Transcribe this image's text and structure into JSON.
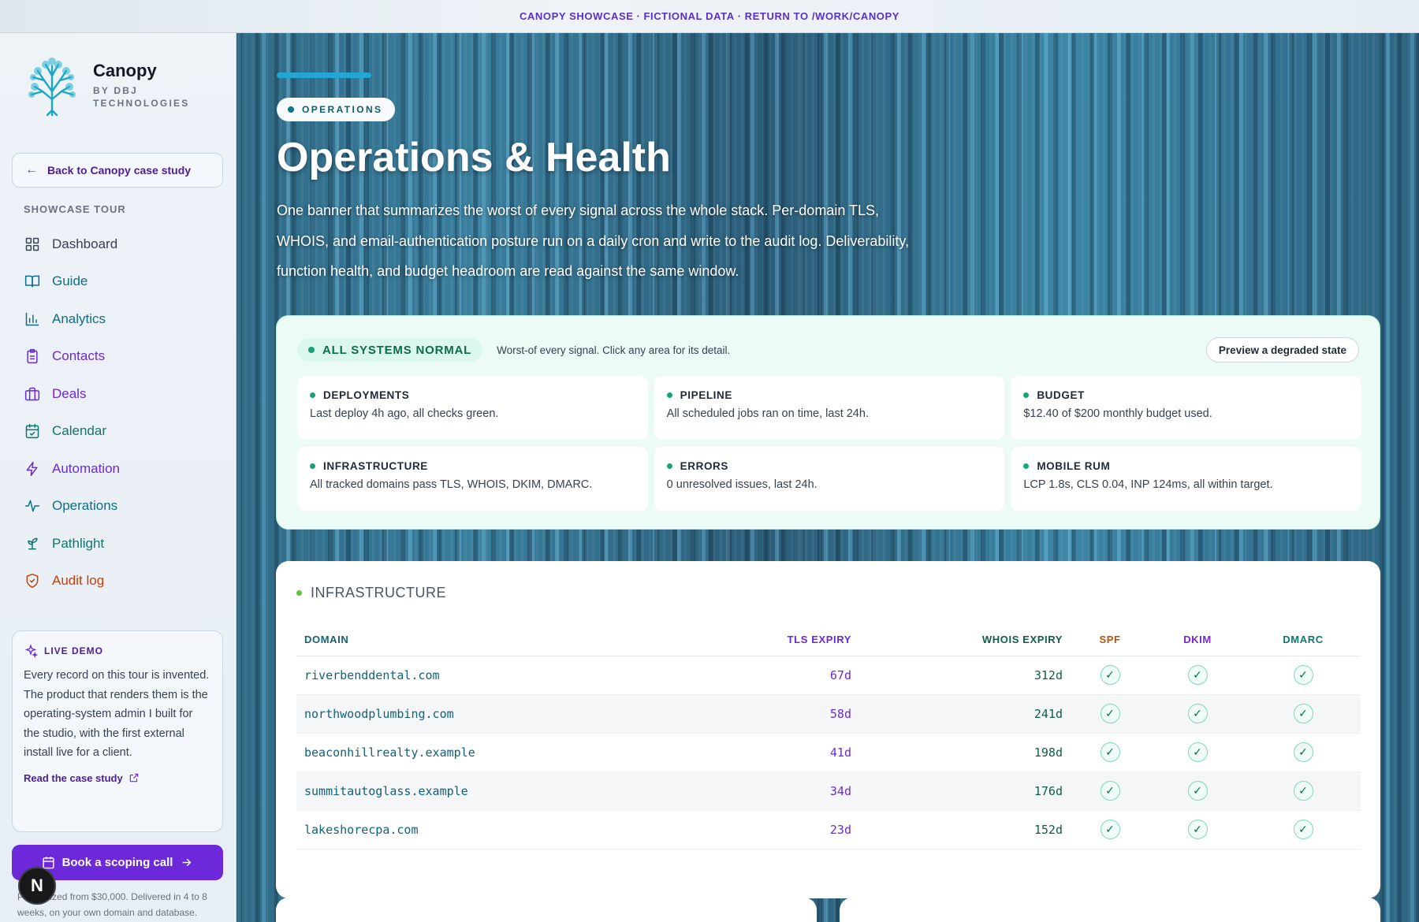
{
  "topbar": {
    "a": "CANOPY SHOWCASE",
    "sep": "·",
    "b": "FICTIONAL DATA",
    "c": "RETURN TO /WORK/CANOPY"
  },
  "brand": {
    "name": "Canopy",
    "sub1": "BY DBJ",
    "sub2": "TECHNOLOGIES"
  },
  "sidebar": {
    "back_label": "Back to Canopy case study",
    "tour_label": "SHOWCASE TOUR",
    "items": [
      {
        "label": "Dashboard",
        "icon": "grid-icon",
        "color": "#374151"
      },
      {
        "label": "Guide",
        "icon": "book-icon",
        "color": "#0e6e8a"
      },
      {
        "label": "Analytics",
        "icon": "bar-chart-icon",
        "color": "#0e6e8a"
      },
      {
        "label": "Contacts",
        "icon": "clipboard-icon",
        "color": "#6d28d9"
      },
      {
        "label": "Deals",
        "icon": "briefcase-icon",
        "color": "#6d28d9"
      },
      {
        "label": "Calendar",
        "icon": "calendar-icon",
        "color": "#0f766e"
      },
      {
        "label": "Automation",
        "icon": "lightning-icon",
        "color": "#6d28d9"
      },
      {
        "label": "Operations",
        "icon": "pulse-icon",
        "color": "#0e6e8a"
      },
      {
        "label": "Pathlight",
        "icon": "sprout-icon",
        "color": "#0f766e"
      },
      {
        "label": "Audit log",
        "icon": "shield-icon",
        "color": "#c2410c"
      }
    ]
  },
  "demo": {
    "title": "LIVE DEMO",
    "body": "Every record on this tour is invented. The product that renders them is the operating-system admin I built for the studio, with the first external install live for a client.",
    "link": "Read the case study"
  },
  "cta": {
    "label": "Book a scoping call"
  },
  "fine_print": "Productized from $30,000. Delivered in 4 to 8 weeks, on your own domain and database.",
  "avatar": "N",
  "page": {
    "pill": "OPERATIONS",
    "title": "Operations & Health",
    "lead": "One banner that summarizes the worst of every signal across the whole stack. Per-domain TLS, WHOIS, and email-authentication posture run on a daily cron and write to the audit log. Deliverability, function health, and budget headroom are read against the same window."
  },
  "status": {
    "badge": "ALL SYSTEMS NORMAL",
    "desc": "Worst-of every signal. Click any area for its detail.",
    "button": "Preview a degraded state",
    "tiles": [
      {
        "title": "DEPLOYMENTS",
        "text": "Last deploy 4h ago, all checks green."
      },
      {
        "title": "PIPELINE",
        "text": "All scheduled jobs ran on time, last 24h."
      },
      {
        "title": "BUDGET",
        "text": "$12.40 of $200 monthly budget used."
      },
      {
        "title": "INFRASTRUCTURE",
        "text": "All tracked domains pass TLS, WHOIS, DKIM, DMARC."
      },
      {
        "title": "ERRORS",
        "text": "0 unresolved issues, last 24h."
      },
      {
        "title": "MOBILE RUM",
        "text": "LCP 1.8s, CLS 0.04, INP 124ms, all within target."
      }
    ]
  },
  "infra": {
    "title": "INFRASTRUCTURE",
    "columns": {
      "domain": "DOMAIN",
      "tls": "TLS EXPIRY",
      "whois": "WHOIS EXPIRY",
      "spf": "SPF",
      "dkim": "DKIM",
      "dmarc": "DMARC"
    },
    "check": "✓",
    "rows": [
      {
        "domain": "riverbenddental.com",
        "tls": "67d",
        "whois": "312d"
      },
      {
        "domain": "northwoodplumbing.com",
        "tls": "58d",
        "whois": "241d"
      },
      {
        "domain": "beaconhillrealty.example",
        "tls": "41d",
        "whois": "198d"
      },
      {
        "domain": "summitautoglass.example",
        "tls": "34d",
        "whois": "176d"
      },
      {
        "domain": "lakeshorecpa.com",
        "tls": "23d",
        "whois": "152d"
      }
    ]
  }
}
